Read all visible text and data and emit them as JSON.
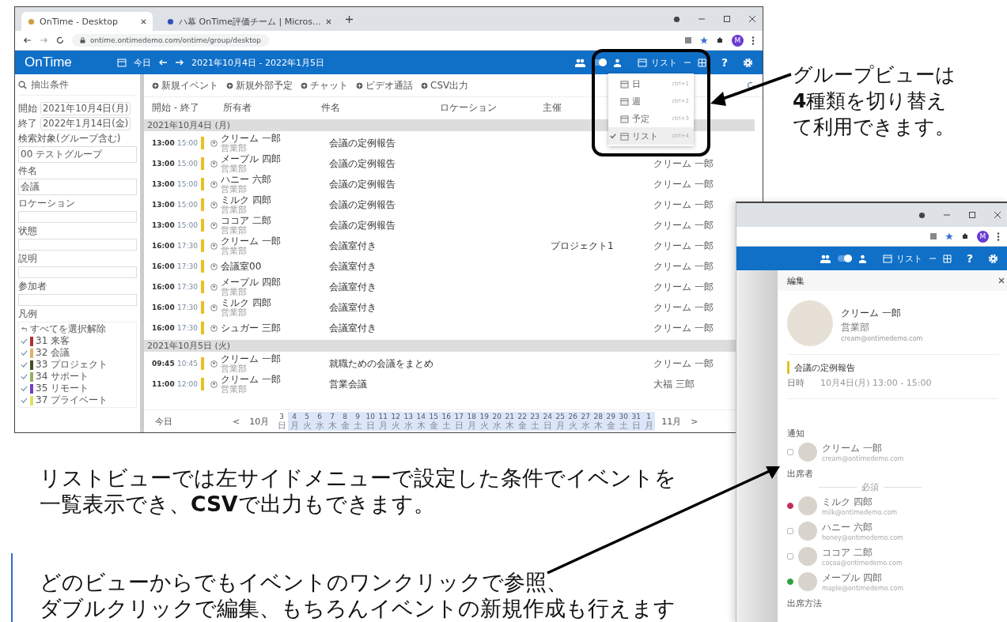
{
  "main_window": {
    "browser": {
      "tabs": [
        {
          "title": "OnTime - Desktop",
          "selected": true
        },
        {
          "title": "ハ幕 OnTime評価チーム | Micros...",
          "selected": false
        }
      ],
      "url": "ontime.ontimedemo.com/ontime/group/desktop",
      "avatar_letter": "M"
    },
    "app_bar": {
      "toggle_on": true,
      "logo": "OnTime",
      "today": "今日",
      "range": "2021年10月4日 - 2022年1月5日",
      "view": "リスト",
      "help": "?"
    },
    "sidebar": {
      "search": "抽出条件",
      "fields": [
        {
          "kind": "date",
          "label": "開始",
          "value": "2021年10月4日(月)"
        },
        {
          "kind": "date",
          "label": "終了",
          "value": "2022年1月14日(金)"
        },
        {
          "kind": "chips",
          "label": "検索対象(グループ含む)",
          "chip": "00 テストグループ"
        },
        {
          "kind": "chips",
          "label": "件名",
          "chip": "会議"
        },
        {
          "kind": "text",
          "label": "ロケーション"
        },
        {
          "kind": "text",
          "label": "状態"
        },
        {
          "kind": "text",
          "label": "説明"
        },
        {
          "kind": "text",
          "label": "参加者"
        }
      ],
      "legend": {
        "label": "凡例",
        "deselect": "すべてを選択解除",
        "items": [
          {
            "label": "31 来客",
            "color": "#b03030",
            "checked": true
          },
          {
            "label": "32 会議",
            "color": "#e0b070",
            "checked": true
          },
          {
            "label": "33 プロジェクト",
            "color": "#405020",
            "checked": true
          },
          {
            "label": "34 サポート",
            "color": "#90b060",
            "checked": true
          },
          {
            "label": "35 リモート",
            "color": "#7040c0",
            "checked": true
          },
          {
            "label": "37 プライベート",
            "color": "#e0e060",
            "checked": true
          }
        ]
      }
    },
    "toolbar": [
      "新規イベント",
      "新規外部予定",
      "チャット",
      "ビデオ通話",
      "CSV出力"
    ],
    "columns": [
      "開始 - 終了",
      "所有者",
      "件名",
      "ロケーション",
      "主催"
    ],
    "groups": [
      {
        "date": "2021年10月4日 (月)",
        "rows": [
          {
            "start": "13:00",
            "end": "15:00",
            "color": "#e8c020",
            "owner": "クリーム 一郎",
            "dept": "営業部",
            "subject": "会議の定例報告"
          },
          {
            "start": "13:00",
            "end": "15:00",
            "color": "#e8c020",
            "owner": "メープル 四郎",
            "dept": "営業部",
            "subject": "会議の定例報告",
            "column_6": "クリーム 一郎"
          },
          {
            "start": "13:00",
            "end": "15:00",
            "color": "#e8c020",
            "owner": "ハニー 六郎",
            "dept": "営業部",
            "subject": "会議の定例報告",
            "column_6": "クリーム 一郎"
          },
          {
            "start": "13:00",
            "end": "15:00",
            "color": "#e8c020",
            "owner": "ミルク 四郎",
            "dept": "営業部",
            "subject": "会議の定例報告",
            "column_6": "クリーム 一郎"
          },
          {
            "start": "13:00",
            "end": "15:00",
            "color": "#e8c020",
            "owner": "ココア 二郎",
            "dept": "営業部",
            "subject": "会議の定例報告",
            "column_6": "クリーム 一郎"
          },
          {
            "start": "16:00",
            "end": "17:30",
            "color": "#e8c020",
            "owner": "クリーム 一郎",
            "dept": "営業部",
            "subject": "会議室付き",
            "column_5": "プロジェクト1",
            "column_6": "クリーム 一郎"
          },
          {
            "start": "16:00",
            "end": "17:30",
            "color": "#e8c020",
            "owner": "会議室00",
            "subject": "会議室付き",
            "column_6": "クリーム 一郎"
          },
          {
            "start": "16:00",
            "end": "17:30",
            "color": "#e8c020",
            "owner": "メープル 四郎",
            "dept": "営業部",
            "subject": "会議室付き",
            "column_6": "クリーム 一郎"
          },
          {
            "start": "16:00",
            "end": "17:30",
            "color": "#e8c020",
            "owner": "ミルク 四郎",
            "dept": "営業部",
            "subject": "会議室付き",
            "column_6": "クリーム 一郎"
          },
          {
            "start": "16:00",
            "end": "17:30",
            "color": "#e8c020",
            "owner": "シュガー 三郎",
            "subject": "会議室付き",
            "column_6": "クリーム 一郎"
          }
        ]
      },
      {
        "date": "2021年10月5日 (火)",
        "rows": [
          {
            "start": "09:45",
            "end": "10:45",
            "color": "#e8c020",
            "owner": "クリーム 一郎",
            "dept": "営業部",
            "subject": "就職ための会議をまとめ",
            "column_6": "クリーム 一郎"
          },
          {
            "start": "11:00",
            "end": "12:00",
            "color": "#e8c020",
            "owner": "クリーム 一郎",
            "dept": "営業部",
            "subject": "営業会議",
            "column_6": "大福 三郎"
          }
        ]
      }
    ],
    "footer": {
      "today": "今日",
      "prev": "<",
      "month": "10月",
      "next_month": "11月",
      "next": ">",
      "days": [
        {
          "d": "3",
          "wd": "日",
          "selected": false
        },
        {
          "d": "4",
          "wd": "月",
          "selected": true
        },
        {
          "d": "5",
          "wd": "火",
          "selected": true
        },
        {
          "d": "6",
          "wd": "水",
          "selected": true
        },
        {
          "d": "7",
          "wd": "木",
          "selected": true
        },
        {
          "d": "8",
          "wd": "金",
          "selected": true
        },
        {
          "d": "9",
          "wd": "土",
          "selected": true
        },
        {
          "d": "10",
          "wd": "日",
          "selected": true
        },
        {
          "d": "11",
          "wd": "月",
          "selected": true
        },
        {
          "d": "12",
          "wd": "火",
          "selected": true
        },
        {
          "d": "13",
          "wd": "水",
          "selected": true
        },
        {
          "d": "14",
          "wd": "木",
          "selected": true
        },
        {
          "d": "15",
          "wd": "金",
          "selected": true
        },
        {
          "d": "16",
          "wd": "土",
          "selected": true
        },
        {
          "d": "17",
          "wd": "日",
          "selected": true
        },
        {
          "d": "18",
          "wd": "月",
          "selected": true
        },
        {
          "d": "19",
          "wd": "火",
          "selected": true
        },
        {
          "d": "20",
          "wd": "水",
          "selected": true
        },
        {
          "d": "21",
          "wd": "木",
          "selected": true
        },
        {
          "d": "22",
          "wd": "金",
          "selected": true
        },
        {
          "d": "23",
          "wd": "土",
          "selected": true
        },
        {
          "d": "24",
          "wd": "日",
          "selected": true
        },
        {
          "d": "25",
          "wd": "月",
          "selected": true
        },
        {
          "d": "26",
          "wd": "火",
          "selected": true
        },
        {
          "d": "27",
          "wd": "水",
          "selected": true
        },
        {
          "d": "28",
          "wd": "木",
          "selected": true
        },
        {
          "d": "29",
          "wd": "金",
          "selected": true
        },
        {
          "d": "30",
          "wd": "土",
          "selected": true
        },
        {
          "d": "31",
          "wd": "日",
          "selected": true
        },
        {
          "d": "1",
          "wd": "月",
          "selected": true
        }
      ]
    },
    "view_menu": [
      {
        "label": "日",
        "shortcut": "ctrl+1",
        "checked": false
      },
      {
        "label": "週",
        "shortcut": "ctrl+2",
        "checked": false
      },
      {
        "label": "予定",
        "shortcut": "ctrl+3",
        "checked": false
      },
      {
        "label": "リスト",
        "shortcut": "ctrl+4",
        "checked": true
      }
    ]
  },
  "detail_window": {
    "toggle_on": true,
    "avatar_letter": "M",
    "view": "リスト",
    "help": "?",
    "panel": {
      "title": "編集",
      "person": {
        "name": "クリーム 一郎",
        "dept": "営業部",
        "email": "cream@ontimedemo.com"
      },
      "event": {
        "title": "会議の定例報告",
        "color": "#e8c020",
        "when_label": "日時",
        "when": "10月4日(月) 13:00 - 15:00"
      },
      "notify_label": "通知",
      "notify": {
        "name": "クリーム 一郎",
        "email": "cream@ontimedemo.com"
      },
      "attendees_label": "出席者",
      "required_label": "必須",
      "attendees": [
        {
          "name": "ミルク 四郎",
          "email": "milk@ontimedemo.com",
          "color": "#c0305a"
        },
        {
          "name": "ハニー 六郎",
          "email": "honey@ontimedemo.com"
        },
        {
          "name": "ココア 二郎",
          "email": "cocoa@ontimedemo.com"
        },
        {
          "name": "メープル 四郎",
          "email": "maple@ontimedemo.com",
          "color": "#30a040"
        }
      ],
      "more_label": "出席方法"
    }
  },
  "callouts": {
    "top": [
      "グループビューは",
      "**4**種類を切り替え",
      "て利用できます。"
    ],
    "list": [
      "リストビューでは左サイドメニューで設定した条件でイベントを",
      "一覧表示でき、**CSV**で出力もできます。"
    ],
    "click": [
      "どのビューからでもイベントのワンクリックで参照、",
      "ダブルクリックで編集、もちろんイベントの新規作成も行えます"
    ]
  }
}
